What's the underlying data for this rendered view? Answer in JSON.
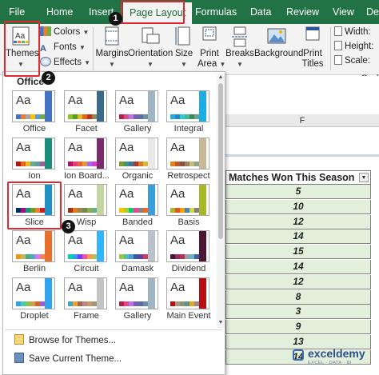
{
  "tabs": [
    "File",
    "Home",
    "Insert",
    "Page Layout",
    "Formulas",
    "Data",
    "Review",
    "View",
    "De"
  ],
  "ribbon": {
    "themes_label": "Themes",
    "colors_label": "Colors",
    "fonts_label": "Fonts",
    "effects_label": "Effects",
    "margins_label": "Margins",
    "orientation_label": "Orientation",
    "size_label": "Size",
    "print_area_label": [
      "Print",
      "Area"
    ],
    "breaks_label": "Breaks",
    "background_label": "Background",
    "print_titles_label": [
      "Print",
      "Titles"
    ],
    "width_label": "Width:",
    "height_label": "Height:",
    "scale_label": "Scale:",
    "scale_group_label": "Scale"
  },
  "steps": [
    "1",
    "2",
    "3"
  ],
  "gallery": {
    "title": "Office",
    "themes": [
      {
        "name": "Office",
        "accent": "#4472c4",
        "sw": [
          "#4472c4",
          "#ed7d31",
          "#a5a5a5",
          "#ffc000",
          "#5b9bd5",
          "#70ad47"
        ]
      },
      {
        "name": "Facet",
        "accent": "#3b6b8c",
        "sw": [
          "#90c226",
          "#54a021",
          "#e6b91e",
          "#e76618",
          "#c42f1a",
          "#918655"
        ]
      },
      {
        "name": "Gallery",
        "accent": "#9fb5c4",
        "sw": [
          "#b71e42",
          "#de478e",
          "#bc72f0",
          "#795faf",
          "#586ea6",
          "#6892a0"
        ]
      },
      {
        "name": "Integral",
        "accent": "#1cade4",
        "sw": [
          "#1cade4",
          "#2683c6",
          "#27ced7",
          "#42ba97",
          "#3e8853",
          "#62a39f"
        ]
      },
      {
        "name": "Ion",
        "accent": "#1b8f7c",
        "sw": [
          "#b01513",
          "#ea6312",
          "#e6b729",
          "#6aac90",
          "#5f9c9d",
          "#9e5e9b"
        ]
      },
      {
        "name": "Ion Board...",
        "accent": "#7a2c6f",
        "sw": [
          "#b31166",
          "#e33d6f",
          "#e45f3c",
          "#e9943a",
          "#9b6bf2",
          "#d53dd0"
        ]
      },
      {
        "name": "Organic",
        "accent": "#e8e8e8",
        "sw": [
          "#83992a",
          "#3c9770",
          "#44709d",
          "#a23c33",
          "#d97828",
          "#deb340"
        ]
      },
      {
        "name": "Retrospect",
        "accent": "#c8b896",
        "sw": [
          "#e48312",
          "#bd582c",
          "#865640",
          "#9b8357",
          "#c2bc80",
          "#94a088"
        ]
      },
      {
        "name": "Slice",
        "accent": "#1f90c6",
        "sw": [
          "#052f61",
          "#a50e82",
          "#14967c",
          "#6a9e1f",
          "#e87d37",
          "#c62324"
        ]
      },
      {
        "name": "Wisp",
        "accent": "#c4d6a0",
        "sw": [
          "#a53010",
          "#de7e18",
          "#9f8351",
          "#728653",
          "#92aa4c",
          "#6aac91"
        ]
      },
      {
        "name": "Banded",
        "accent": "#3a9fd8",
        "sw": [
          "#ffc000",
          "#a5d028",
          "#08cc78",
          "#f24099",
          "#828288",
          "#f56617"
        ]
      },
      {
        "name": "Basis",
        "accent": "#a6b727",
        "sw": [
          "#a6b727",
          "#df5327",
          "#fe9e00",
          "#418ab3",
          "#d7d447",
          "#818183"
        ]
      },
      {
        "name": "Berlin",
        "accent": "#e8702a",
        "sw": [
          "#f09415",
          "#c1b56b",
          "#4baf73",
          "#5aa6c0",
          "#d17df9",
          "#fa7e5c"
        ]
      },
      {
        "name": "Circuit",
        "accent": "#31b6fd",
        "sw": [
          "#03d4a8",
          "#3b94fa",
          "#6d3eff",
          "#f051a1",
          "#fb9a4b",
          "#b2c35b"
        ]
      },
      {
        "name": "Damask",
        "accent": "#b8c2cc",
        "sw": [
          "#9ec544",
          "#50bea3",
          "#4a9bdc",
          "#2f5f98",
          "#6b3d9a",
          "#cc3c62"
        ]
      },
      {
        "name": "Dividend",
        "accent": "#4d1434",
        "sw": [
          "#4d1434",
          "#903163",
          "#b2324b",
          "#969fa7",
          "#66b1ce",
          "#40619d"
        ]
      },
      {
        "name": "Droplet",
        "accent": "#2fa3ee",
        "sw": [
          "#2fa3ee",
          "#4bcaad",
          "#86c157",
          "#d99c3f",
          "#ce6633",
          "#a35dd1"
        ]
      },
      {
        "name": "Frame",
        "accent": "#c4c4c4",
        "sw": [
          "#40a7c2",
          "#f0a22e",
          "#a5644e",
          "#b58b80",
          "#c3986d",
          "#a19574"
        ]
      },
      {
        "name": "Gallery",
        "accent": "#9fb5c4",
        "sw": [
          "#b71e42",
          "#de478e",
          "#bc72f0",
          "#795faf",
          "#586ea6",
          "#6892a0"
        ]
      },
      {
        "name": "Main Event",
        "accent": "#b80e0f",
        "sw": [
          "#b80e0f",
          "#a6987d",
          "#7f9a71",
          "#64908a",
          "#e8a915",
          "#968c8c"
        ]
      }
    ]
  },
  "dropdown_actions": [
    "Browse for Themes...",
    "Save Current Theme..."
  ],
  "sheet": {
    "column_letter": "F",
    "header": "Matches Won This Season",
    "values": [
      "5",
      "10",
      "12",
      "14",
      "15",
      "14",
      "12",
      "8",
      "3",
      "9",
      "13",
      "14"
    ]
  },
  "watermark": {
    "name": "exceldemy",
    "tagline": "EXCEL · DATA · BI"
  }
}
